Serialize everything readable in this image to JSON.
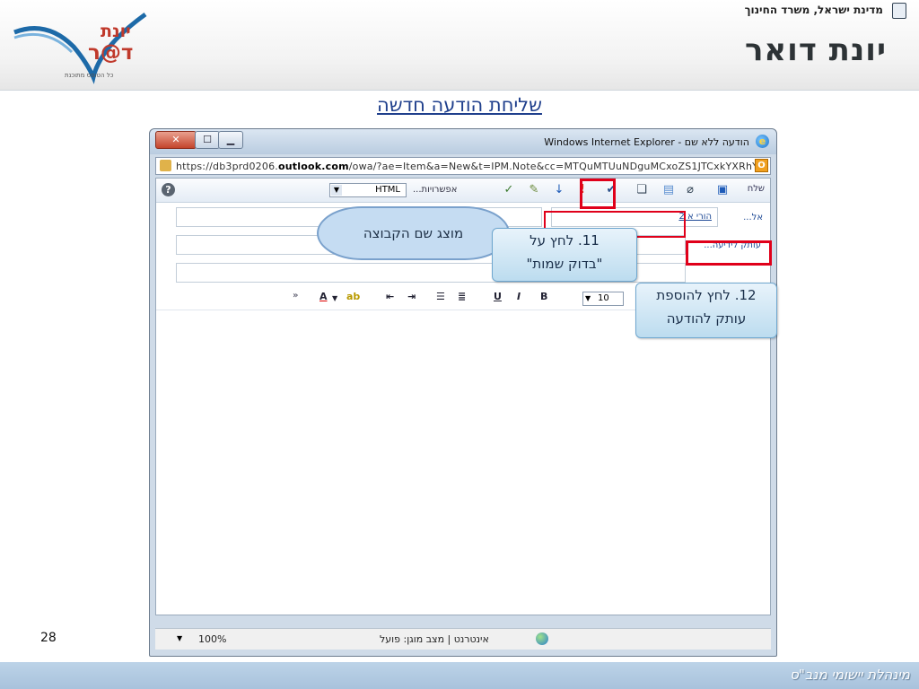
{
  "header": {
    "ministry": "מדינת ישראל, משרד החינוך",
    "app_title": "יונת דואר",
    "logo_line1": "יונת",
    "logo_line2": "ד@ר",
    "logo_tagline": "כל הטופס מתוכנת"
  },
  "page_title": "שליחת הודעה חדשה",
  "window": {
    "title": "הודעה ללא שם - Windows Internet Explorer",
    "address": "https://db3prd0206.outlook.com/owa/?ae=Item&a=New&t=IPM.Note&cc=MTQuMTUuNDguMCxoZS1JTCxkYXRhY2",
    "address_host": "outlook.com",
    "compat_icon": "O"
  },
  "toolbar": {
    "send_label": "שלח",
    "options_label": "אפשרויות...",
    "format_value": "HTML",
    "help_icon": "?"
  },
  "fields": {
    "to_label": "אל...",
    "to_value": "הורי א 2",
    "cc_label": "עותק לידיעה..."
  },
  "format_bar": {
    "font_size": "10",
    "bold": "B",
    "italic": "I",
    "underline": "U",
    "font_color": "A"
  },
  "status_bar": {
    "text": "אינטרנט | מצב מוגן: פועל",
    "zoom": "100%"
  },
  "callouts": {
    "group_shown": "מוצג שם הקבוצה",
    "step11_line1": "11. לחץ על",
    "step11_line2": "\"בדוק שמות\"",
    "step12_line1": "12. לחץ להוספת",
    "step12_line2": "עותק להודעה"
  },
  "page_number": "28",
  "footer": "מינהלת יישומי מנב\"ס",
  "colors": {
    "highlight": "#e0001a",
    "footer_bg": "#a8c2dc",
    "title_blue": "#1f3f8c"
  }
}
